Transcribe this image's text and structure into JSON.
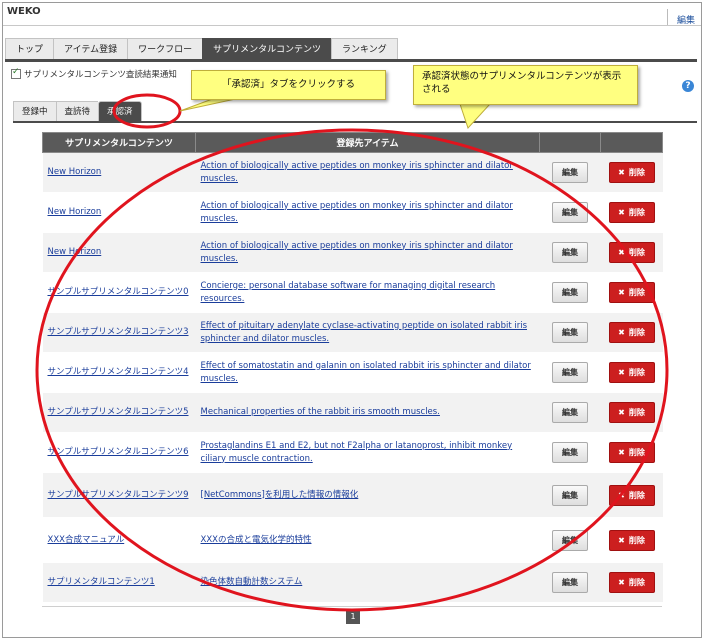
{
  "app": {
    "title": "WEKO",
    "edit_link": "編集"
  },
  "main_tabs": [
    {
      "label": "トップ"
    },
    {
      "label": "アイテム登録"
    },
    {
      "label": "ワークフロー"
    },
    {
      "label": "サプリメンタルコンテンツ",
      "active": true
    },
    {
      "label": "ランキング"
    }
  ],
  "notify_label": "サプリメンタルコンテンツ査読結果通知",
  "sub_tabs": [
    {
      "label": "登録中"
    },
    {
      "label": "査読待"
    },
    {
      "label": "承認済",
      "active": true
    }
  ],
  "table": {
    "headers": [
      "サプリメンタルコンテンツ",
      "登録先アイテム",
      "",
      ""
    ],
    "edit_label": "編集",
    "delete_label": "削除",
    "rows": [
      {
        "content": "New Horizon",
        "item": "Action of biologically active peptides on monkey iris sphincter and dilator muscles."
      },
      {
        "content": "New Horizon",
        "item": "Action of biologically active peptides on monkey iris sphincter and dilator muscles."
      },
      {
        "content": "New Horizon",
        "item": "Action of biologically active peptides on monkey iris sphincter and dilator muscles."
      },
      {
        "content": "サンプルサプリメンタルコンテンツ0",
        "item": "Concierge: personal database software for managing digital research resources."
      },
      {
        "content": "サンプルサプリメンタルコンテンツ3",
        "item": "Effect of pituitary adenylate cyclase-activating peptide on isolated rabbit iris sphincter and dilator muscles."
      },
      {
        "content": "サンプルサプリメンタルコンテンツ4",
        "item": "Effect of somatostatin and galanin on isolated rabbit iris sphincter and dilator muscles."
      },
      {
        "content": "サンプルサプリメンタルコンテンツ5",
        "item": "Mechanical properties of the rabbit iris smooth muscles."
      },
      {
        "content": "サンプルサプリメンタルコンテンツ6",
        "item": "Prostaglandins E1 and E2, but not F2alpha or latanoprost, inhibit monkey ciliary muscle contraction."
      },
      {
        "content": "サンプルサプリメンタルコンテンツ9",
        "item": "[NetCommons]を利用した情報の情報化"
      },
      {
        "content": "XXX合成マニュアル",
        "item": "XXXの合成と電気化学的特性"
      },
      {
        "content": "サプリメンタルコンテンツ1",
        "item": "染色体数自動計数システム"
      }
    ]
  },
  "pager": {
    "current": "1"
  },
  "callouts": {
    "tab_hint": "「承認済」タブをクリックする",
    "table_hint": "承認済状態のサプリメンタルコンテンツが表示される"
  },
  "colors": {
    "annotation_red": "#e0141e",
    "callout_yellow": "#ffff80",
    "delete_red": "#cc1f1f",
    "tab_active": "#4b4b4b"
  }
}
